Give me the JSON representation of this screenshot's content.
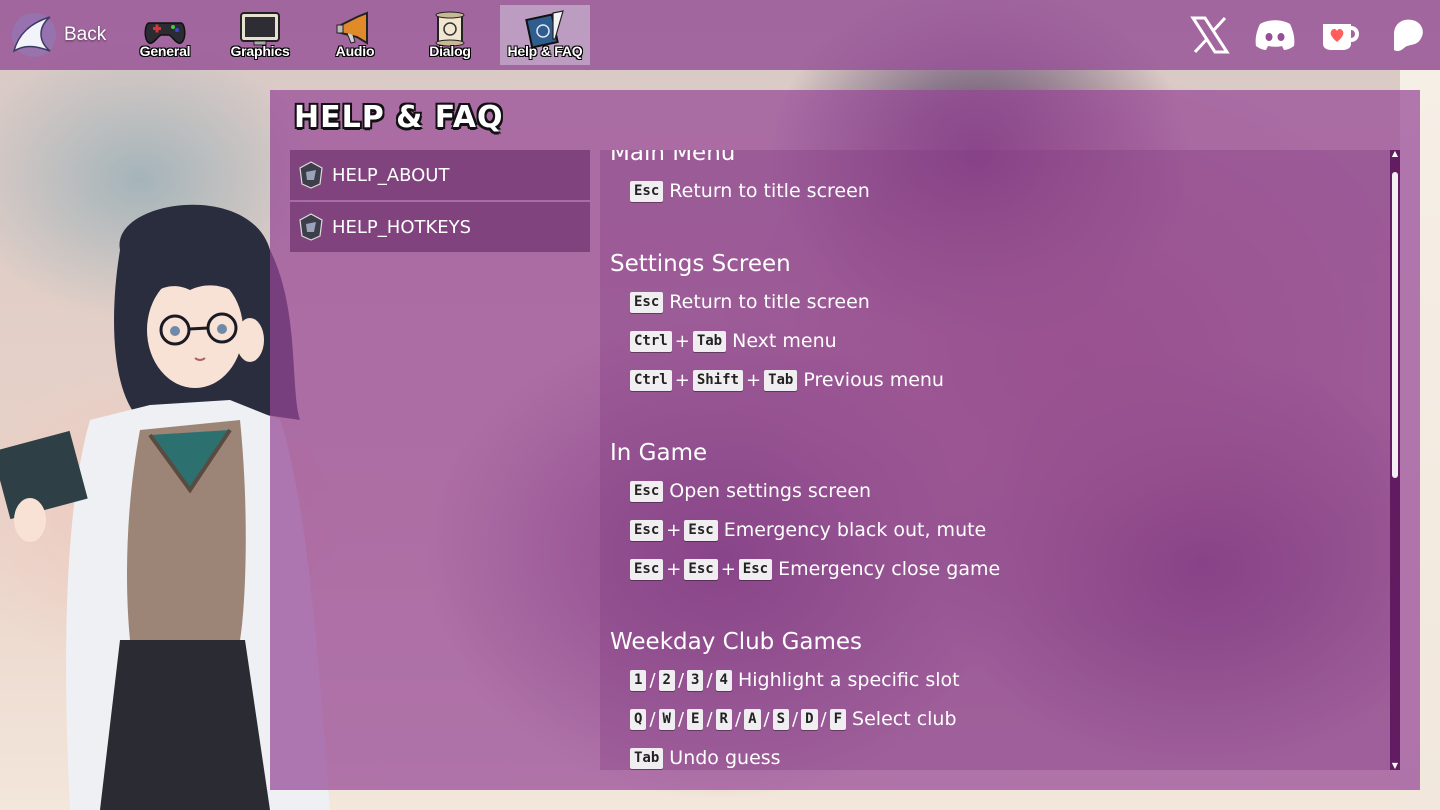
{
  "nav": {
    "back_label": "Back",
    "tabs": [
      {
        "label": "General",
        "icon": "gamepad-icon"
      },
      {
        "label": "Graphics",
        "icon": "monitor-icon"
      },
      {
        "label": "Audio",
        "icon": "megaphone-icon"
      },
      {
        "label": "Dialog",
        "icon": "scroll-icon"
      },
      {
        "label": "Help & FAQ",
        "icon": "book-quill-icon",
        "active": true
      }
    ],
    "social": [
      "x-icon",
      "discord-icon",
      "kofi-icon",
      "patreon-icon"
    ]
  },
  "panel": {
    "title": "HELP & FAQ",
    "menu": [
      {
        "label": "HELP_ABOUT"
      },
      {
        "label": "HELP_HOTKEYS"
      }
    ]
  },
  "content": {
    "sections": [
      {
        "title": "Main Menu",
        "rows": [
          {
            "keys": [
              "Esc"
            ],
            "desc": "Return to title screen"
          }
        ]
      },
      {
        "title": "Settings Screen",
        "rows": [
          {
            "keys": [
              "Esc"
            ],
            "desc": "Return to title screen"
          },
          {
            "keys": [
              "Ctrl",
              "+",
              "Tab"
            ],
            "desc": "Next menu"
          },
          {
            "keys": [
              "Ctrl",
              "+",
              "Shift",
              "+",
              "Tab"
            ],
            "desc": "Previous menu"
          }
        ]
      },
      {
        "title": "In Game",
        "rows": [
          {
            "keys": [
              "Esc"
            ],
            "desc": "Open settings screen"
          },
          {
            "keys": [
              "Esc",
              "+",
              "Esc"
            ],
            "desc": "Emergency black out, mute"
          },
          {
            "keys": [
              "Esc",
              "+",
              "Esc",
              "+",
              "Esc"
            ],
            "desc": "Emergency close game"
          }
        ]
      },
      {
        "title": "Weekday Club Games",
        "rows": [
          {
            "keys": [
              "1",
              "/",
              "2",
              "/",
              "3",
              "/",
              "4"
            ],
            "desc": "Highlight a specific slot"
          },
          {
            "keys": [
              "Q",
              "/",
              "W",
              "/",
              "E",
              "/",
              "R",
              "/",
              "A",
              "/",
              "S",
              "/",
              "D",
              "/",
              "F"
            ],
            "desc": "Select club"
          },
          {
            "keys": [
              "Tab"
            ],
            "desc": "Undo guess"
          }
        ]
      }
    ]
  },
  "colors": {
    "topbar": "#964f96",
    "panel": "#964696",
    "key_bg": "#f1eef1",
    "scrollbar": "#5a145a"
  }
}
